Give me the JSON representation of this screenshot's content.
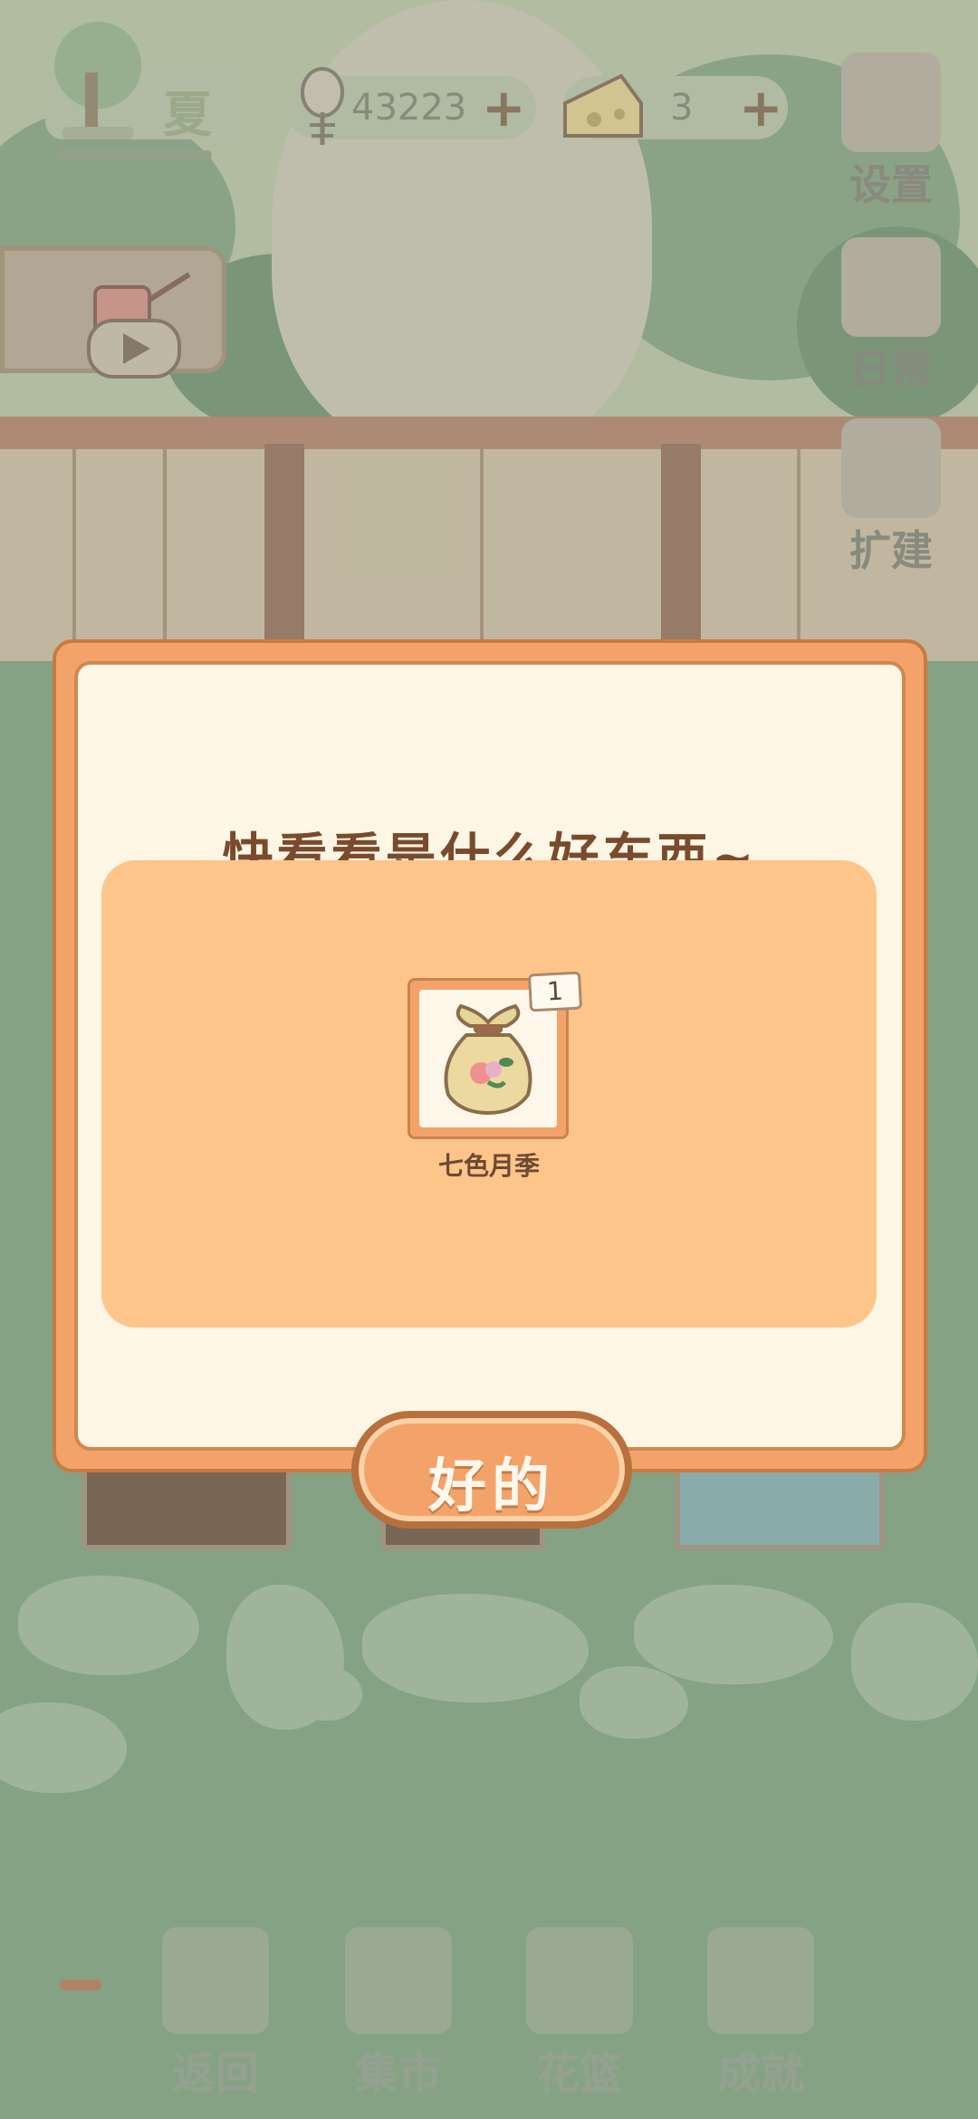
{
  "hud": {
    "season": "夏",
    "fish_coins": "43223",
    "cheese": "3",
    "plus_symbol": "+"
  },
  "side_menu": {
    "settings": "设置",
    "daily": "日常",
    "expand": "扩建"
  },
  "dialog": {
    "title": "快看看是什么好东西~",
    "item": {
      "name": "七色月季",
      "count": "1"
    },
    "confirm": "好的"
  },
  "bottom_nav": {
    "back": "返回",
    "market": "集市",
    "basket": "花篮",
    "achievements": "成就"
  },
  "colors": {
    "accent": "#f3a36a",
    "panel": "#fec58b",
    "dialog_bg": "#fdf6e4",
    "title_text": "#7a4a2d",
    "ground": "#8aa88a"
  },
  "icons": [
    "tree-icon",
    "fish-bone-icon",
    "cheese-icon",
    "gear-icon",
    "notepad-icon",
    "hammer-icon",
    "watering-can-icon",
    "play-icon",
    "seed-bag-icon",
    "window-icon",
    "market-stall-icon",
    "flower-basket-icon",
    "trophy-icon"
  ]
}
